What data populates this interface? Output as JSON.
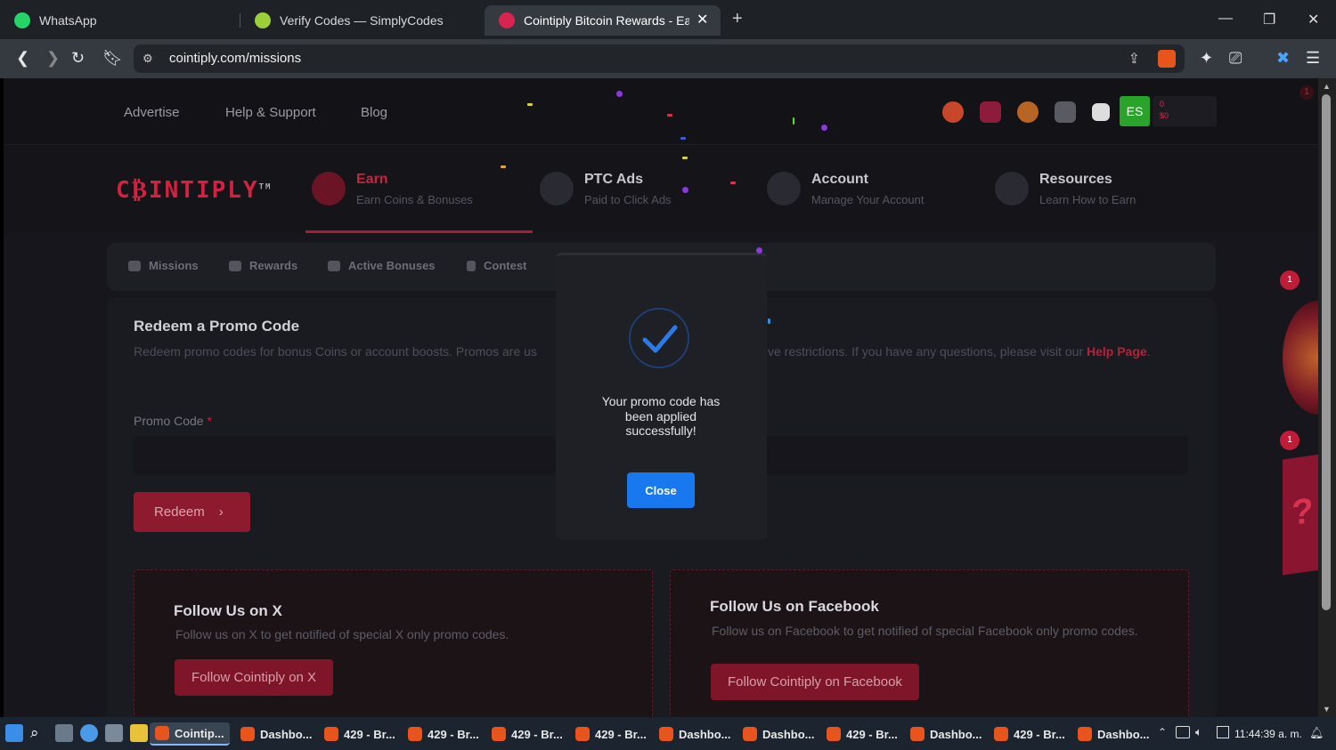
{
  "browser": {
    "tabs": [
      {
        "title": "WhatsApp"
      },
      {
        "title": "Verify Codes — SimplyCodes"
      },
      {
        "title": "Cointiply Bitcoin Rewards - Earn F"
      }
    ],
    "url": "cointiply.com/missions"
  },
  "site": {
    "topnav": {
      "advertise": "Advertise",
      "help": "Help & Support",
      "blog": "Blog"
    },
    "avatar": "ES",
    "balance": {
      "coins": "0",
      "usd": "$0"
    },
    "logo": "C₿INTIPLY",
    "logo_tm": "TM",
    "main_nav": [
      {
        "title": "Earn",
        "subtitle": "Earn Coins & Bonuses"
      },
      {
        "title": "PTC Ads",
        "subtitle": "Paid to Click Ads"
      },
      {
        "title": "Account",
        "subtitle": "Manage Your Account"
      },
      {
        "title": "Resources",
        "subtitle": "Learn How to Earn"
      }
    ],
    "sub_nav": [
      "Missions",
      "Rewards",
      "Active Bonuses",
      "Contest"
    ],
    "promo": {
      "heading": "Redeem a Promo Code",
      "desc_left": "Redeem promo codes for bonus Coins or account boosts. Promos are us",
      "desc_right": "ve restrictions. If you have any questions, please visit our ",
      "help_link": "Help Page",
      "period": ".",
      "label": "Promo Code",
      "required": "*",
      "button": "Redeem"
    },
    "follow_x": {
      "heading": "Follow Us on X",
      "text": "Follow us on X to get notified of special X only promo codes.",
      "button": "Follow Cointiply on X"
    },
    "follow_fb": {
      "heading": "Follow Us on Facebook",
      "text": "Follow us on Facebook to get notified of special Facebook only promo codes.",
      "button": "Follow Cointiply on Facebook"
    },
    "modal": {
      "message": "Your promo code has been applied successfully!",
      "close": "Close"
    },
    "badges": {
      "top": "1",
      "wheel": "1",
      "mystery": "1"
    },
    "mystery_glyph": "?"
  },
  "taskbar": {
    "tasks": [
      "Cointip...",
      "Dashbo...",
      "429 - Br...",
      "429 - Br...",
      "429 - Br...",
      "429 - Br...",
      "Dashbo...",
      "Dashbo...",
      "429 - Br...",
      "Dashbo...",
      "429 - Br...",
      "Dashbo..."
    ],
    "clock": "11:44:39 a. m."
  },
  "colors": {
    "accent": "#c82340",
    "button_blue": "#1878ee",
    "es_green": "#2aa32a"
  }
}
